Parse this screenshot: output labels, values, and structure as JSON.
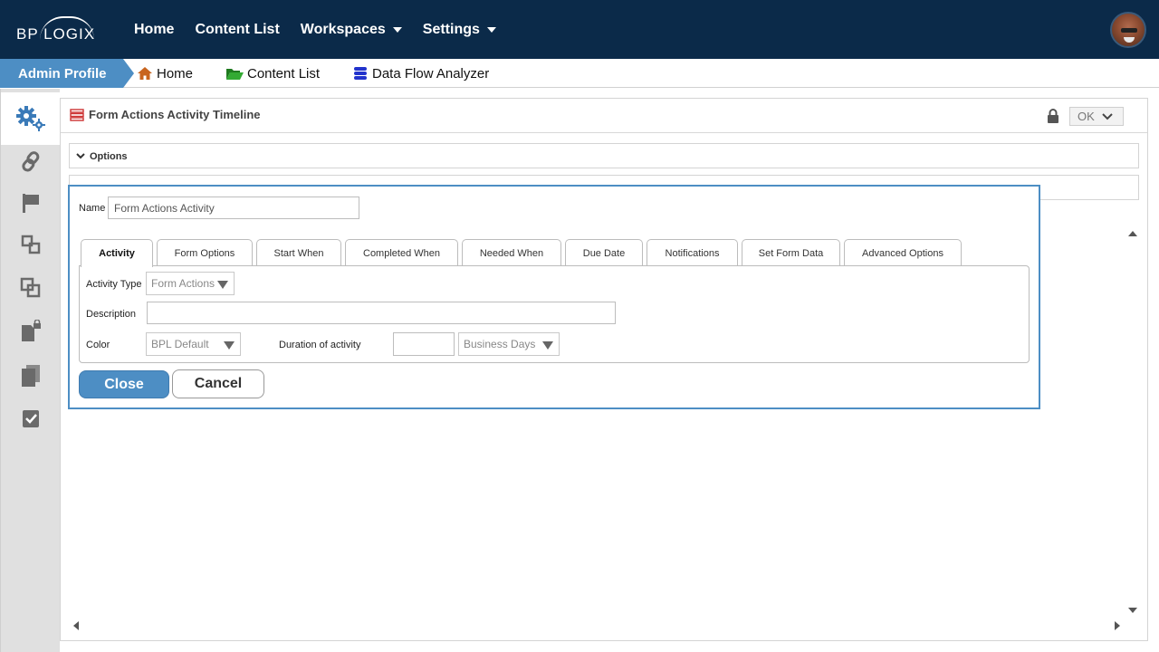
{
  "brand": {
    "logo_text": "BP LOGIX"
  },
  "topnav": {
    "items": [
      {
        "label": "Home",
        "has_caret": false
      },
      {
        "label": "Content List",
        "has_caret": false
      },
      {
        "label": "Workspaces",
        "has_caret": true
      },
      {
        "label": "Settings",
        "has_caret": true
      }
    ]
  },
  "breadcrumb": {
    "profile": "Admin Profile",
    "links": [
      {
        "label": "Home",
        "icon": "home-icon",
        "color": "#c8641e"
      },
      {
        "label": "Content List",
        "icon": "folder-open-icon",
        "color": "#2a9a2a"
      },
      {
        "label": "Data Flow Analyzer",
        "icon": "database-icon",
        "color": "#2233cc"
      }
    ]
  },
  "sidebar": {
    "icons": [
      "gears-icon",
      "link-icon",
      "flag-icon",
      "subprocess-icon",
      "copy-frames-icon",
      "locked-document-icon",
      "documents-icon",
      "checked-document-icon"
    ]
  },
  "panel": {
    "title": "Form Actions Activity Timeline",
    "ok_label": "OK",
    "options_label": "Options"
  },
  "dialog": {
    "name_label": "Name",
    "name_value": "Form Actions Activity",
    "tabs": [
      "Activity",
      "Form Options",
      "Start When",
      "Completed When",
      "Needed When",
      "Due Date",
      "Notifications",
      "Set Form Data",
      "Advanced Options"
    ],
    "active_tab": "Activity",
    "activity_type_label": "Activity Type",
    "activity_type_value": "Form Actions",
    "description_label": "Description",
    "description_value": "",
    "color_label": "Color",
    "color_value": "BPL Default",
    "duration_label": "Duration of activity",
    "duration_value": "",
    "duration_unit": "Business Days",
    "close_label": "Close",
    "cancel_label": "Cancel"
  },
  "colors": {
    "nav_bg": "#0b2a49",
    "accent": "#4d8ec4",
    "sidebar_bg": "#e0e0e0",
    "sidebar_icon": "#6a6a6a",
    "active_icon": "#3a7ab8"
  }
}
